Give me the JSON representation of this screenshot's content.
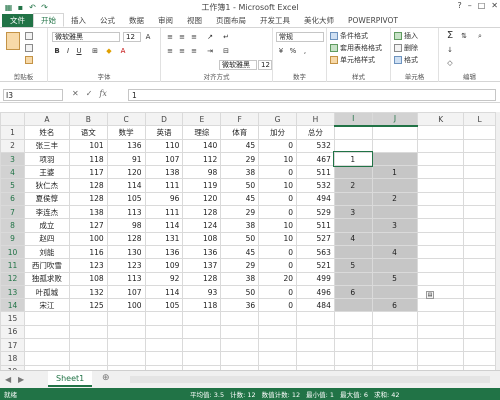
{
  "window": {
    "title": "工作簿1 - Microsoft Excel"
  },
  "tabs": [
    "文件",
    "开始",
    "插入",
    "公式",
    "数据",
    "审阅",
    "视图",
    "页面布局",
    "开发工具",
    "美化大师",
    "POWERPIVOT"
  ],
  "ribbon": {
    "clipboard_label": "剪贴板",
    "font_label": "字体",
    "align_label": "对齐方式",
    "number_label": "数字",
    "styles_label": "样式",
    "cells_label": "单元格",
    "edit_label": "编辑",
    "font_name": "微软雅黑",
    "font_size": "12",
    "font_name2": "微软雅黑",
    "font_size2": "12",
    "number_format": "常规",
    "cond_format": "条件格式",
    "table_format": "套用表格格式",
    "cell_style": "单元格样式",
    "insert": "插入",
    "delete": "删除",
    "format": "格式",
    "sum_symbol": "Σ"
  },
  "formula_bar": {
    "name_box": "I3",
    "fx": "fx",
    "value": "1"
  },
  "columns": [
    "A",
    "B",
    "C",
    "D",
    "E",
    "F",
    "G",
    "H",
    "I",
    "J",
    "K",
    "L"
  ],
  "rows": [
    [
      "姓名",
      "语文",
      "数学",
      "英语",
      "理综",
      "体育",
      "加分",
      "总分",
      "",
      "",
      "",
      ""
    ],
    [
      "张三丰",
      "101",
      "136",
      "110",
      "140",
      "45",
      "0",
      "532",
      "",
      "",
      "",
      ""
    ],
    [
      "项羽",
      "118",
      "91",
      "107",
      "112",
      "29",
      "10",
      "467",
      "1",
      "",
      "",
      ""
    ],
    [
      "王婆",
      "117",
      "120",
      "138",
      "98",
      "38",
      "0",
      "511",
      "",
      "1",
      "",
      ""
    ],
    [
      "狄仁杰",
      "128",
      "114",
      "111",
      "119",
      "50",
      "10",
      "532",
      "2",
      "",
      "",
      ""
    ],
    [
      "夏侯惇",
      "128",
      "105",
      "96",
      "120",
      "45",
      "0",
      "494",
      "",
      "2",
      "",
      ""
    ],
    [
      "李连杰",
      "138",
      "113",
      "111",
      "128",
      "29",
      "0",
      "529",
      "3",
      "",
      "",
      ""
    ],
    [
      "成立",
      "127",
      "98",
      "114",
      "124",
      "38",
      "10",
      "511",
      "",
      "3",
      "",
      ""
    ],
    [
      "赵四",
      "100",
      "128",
      "131",
      "108",
      "50",
      "10",
      "527",
      "4",
      "",
      "",
      ""
    ],
    [
      "刘能",
      "116",
      "130",
      "136",
      "136",
      "45",
      "0",
      "563",
      "",
      "4",
      "",
      ""
    ],
    [
      "西门吹雪",
      "123",
      "123",
      "109",
      "137",
      "29",
      "0",
      "521",
      "5",
      "",
      "",
      ""
    ],
    [
      "独孤求败",
      "108",
      "113",
      "92",
      "128",
      "38",
      "20",
      "499",
      "",
      "5",
      "",
      ""
    ],
    [
      "叶孤城",
      "132",
      "107",
      "114",
      "93",
      "50",
      "0",
      "496",
      "6",
      "",
      "",
      ""
    ],
    [
      "宋江",
      "125",
      "100",
      "105",
      "118",
      "36",
      "0",
      "484",
      "",
      "6",
      "",
      ""
    ],
    [
      "",
      "",
      "",
      "",
      "",
      "",
      "",
      "",
      "",
      "",
      "",
      ""
    ],
    [
      "",
      "",
      "",
      "",
      "",
      "",
      "",
      "",
      "",
      "",
      "",
      ""
    ],
    [
      "",
      "",
      "",
      "",
      "",
      "",
      "",
      "",
      "",
      "",
      "",
      ""
    ],
    [
      "",
      "",
      "",
      "",
      "",
      "",
      "",
      "",
      "",
      "",
      "",
      ""
    ],
    [
      "",
      "",
      "",
      "",
      "",
      "",
      "",
      "",
      "",
      "",
      "",
      ""
    ]
  ],
  "sheet": {
    "tab": "Sheet1",
    "add": "⊕"
  },
  "status": {
    "ready": "就绪",
    "average": "平均值: 3.5",
    "count": "计数: 12",
    "numcount": "数值计数: 12",
    "min": "最小值: 1",
    "max": "最大值: 6",
    "sum": "求和: 42"
  },
  "colors": {
    "accent": "#217346",
    "selection": "#c6c6c6"
  }
}
